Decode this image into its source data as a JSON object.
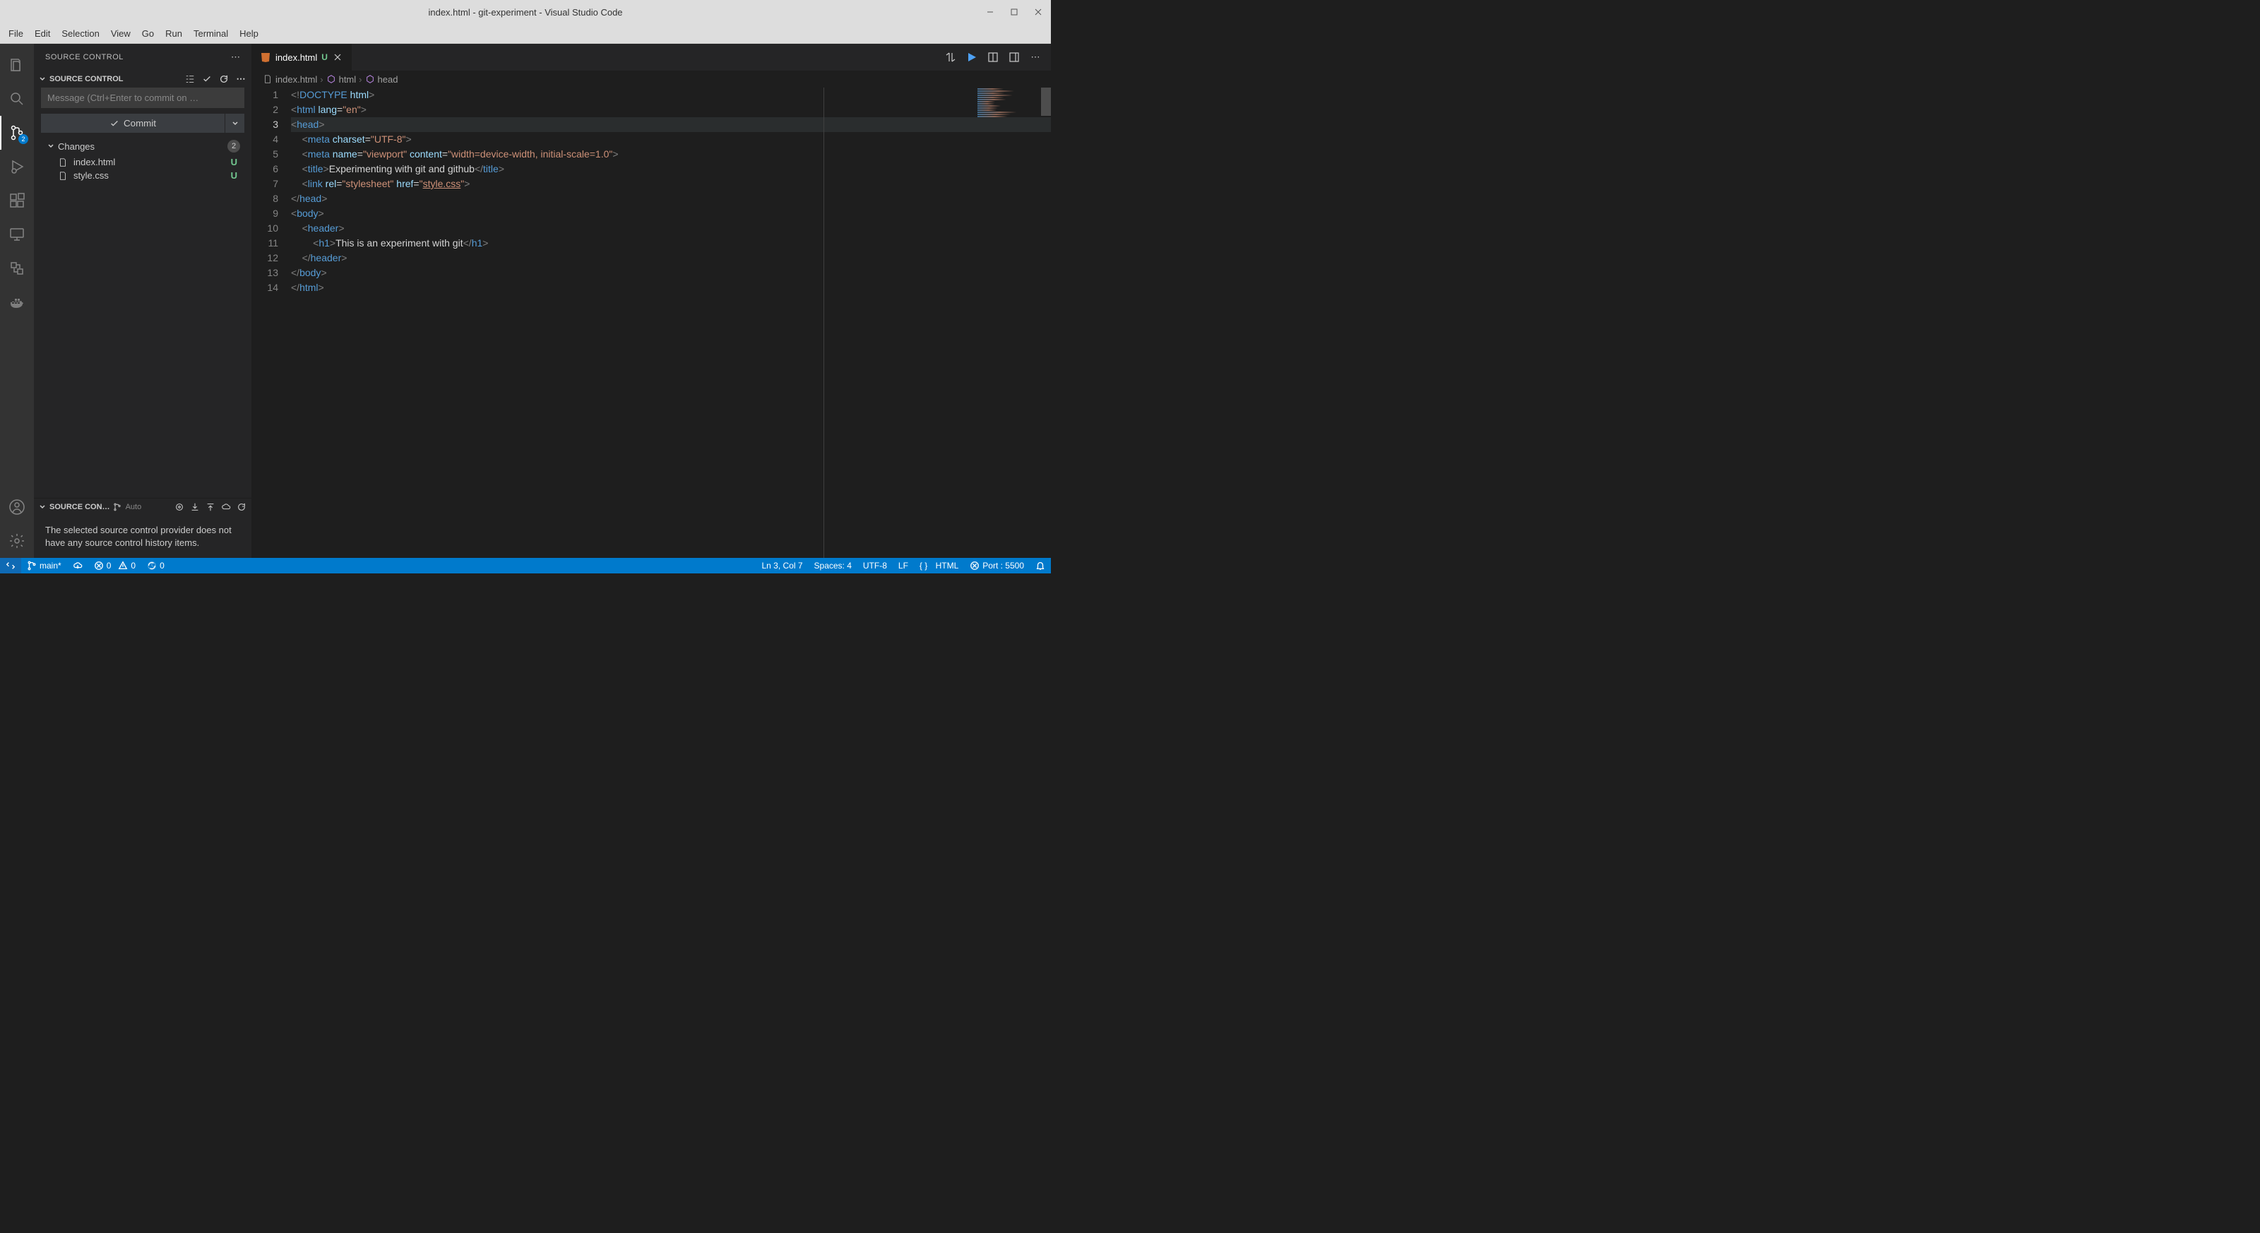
{
  "titlebar": {
    "title": "index.html - git-experiment - Visual Studio Code"
  },
  "menubar": {
    "items": [
      "File",
      "Edit",
      "Selection",
      "View",
      "Go",
      "Run",
      "Terminal",
      "Help"
    ]
  },
  "activitybar": {
    "scm_badge": "2"
  },
  "sidebar": {
    "title": "SOURCE CONTROL",
    "panel_label": "SOURCE CONTROL",
    "commit_placeholder": "Message (Ctrl+Enter to commit on …",
    "commit_button": "Commit",
    "changes_label": "Changes",
    "changes_count": "2",
    "files": [
      {
        "name": "index.html",
        "status": "U"
      },
      {
        "name": "style.css",
        "status": "U"
      }
    ],
    "graph_label": "SOURCE CON…",
    "graph_auto": "Auto",
    "graph_empty": "The selected source control provider does not have any source control history items."
  },
  "tab": {
    "label": "index.html",
    "status": "U"
  },
  "breadcrumbs": {
    "file": "index.html",
    "path1": "html",
    "path2": "head"
  },
  "code_lines": [
    {
      "n": "1",
      "indent": 0,
      "html": "<span class='tk-bracket'>&lt;!</span><span class='tk-doctype-kw'>DOCTYPE</span><span class='tk-text'> </span><span class='tk-attr'>html</span><span class='tk-bracket'>&gt;</span>"
    },
    {
      "n": "2",
      "indent": 0,
      "html": "<span class='tk-bracket'>&lt;</span><span class='tk-tag'>html</span><span class='tk-text'> </span><span class='tk-attr'>lang</span><span class='tk-text'>=</span><span class='tk-string'>\"en\"</span><span class='tk-bracket'>&gt;</span>"
    },
    {
      "n": "3",
      "indent": 0,
      "active": true,
      "html": "<span class='tk-bracket'>&lt;</span><span class='tk-tag'>head</span><span class='tk-bracket'>&gt;</span>"
    },
    {
      "n": "4",
      "indent": 1,
      "html": "<span class='tk-bracket'>&lt;</span><span class='tk-tag'>meta</span><span class='tk-text'> </span><span class='tk-attr'>charset</span><span class='tk-text'>=</span><span class='tk-string'>\"UTF-8\"</span><span class='tk-bracket'>&gt;</span>"
    },
    {
      "n": "5",
      "indent": 1,
      "html": "<span class='tk-bracket'>&lt;</span><span class='tk-tag'>meta</span><span class='tk-text'> </span><span class='tk-attr'>name</span><span class='tk-text'>=</span><span class='tk-string'>\"viewport\"</span><span class='tk-text'> </span><span class='tk-attr'>content</span><span class='tk-text'>=</span><span class='tk-string'>\"width=device-width, initial-scale=1.0\"</span><span class='tk-bracket'>&gt;</span>"
    },
    {
      "n": "6",
      "indent": 1,
      "html": "<span class='tk-bracket'>&lt;</span><span class='tk-tag'>title</span><span class='tk-bracket'>&gt;</span><span class='tk-text'>Experimenting with git and github</span><span class='tk-bracket'>&lt;/</span><span class='tk-tag'>title</span><span class='tk-bracket'>&gt;</span>"
    },
    {
      "n": "7",
      "indent": 1,
      "html": "<span class='tk-bracket'>&lt;</span><span class='tk-tag'>link</span><span class='tk-text'> </span><span class='tk-attr'>rel</span><span class='tk-text'>=</span><span class='tk-string'>\"stylesheet\"</span><span class='tk-text'> </span><span class='tk-attr'>href</span><span class='tk-text'>=</span><span class='tk-string'>\"</span><span class='tk-string tk-link'>style.css</span><span class='tk-string'>\"</span><span class='tk-bracket'>&gt;</span>"
    },
    {
      "n": "8",
      "indent": 0,
      "html": "<span class='tk-bracket'>&lt;/</span><span class='tk-tag'>head</span><span class='tk-bracket'>&gt;</span>"
    },
    {
      "n": "9",
      "indent": 0,
      "html": "<span class='tk-bracket'>&lt;</span><span class='tk-tag'>body</span><span class='tk-bracket'>&gt;</span>"
    },
    {
      "n": "10",
      "indent": 1,
      "html": "<span class='tk-bracket'>&lt;</span><span class='tk-tag'>header</span><span class='tk-bracket'>&gt;</span>"
    },
    {
      "n": "11",
      "indent": 2,
      "html": "<span class='tk-bracket'>&lt;</span><span class='tk-tag'>h1</span><span class='tk-bracket'>&gt;</span><span class='tk-text'>This is an experiment with git</span><span class='tk-bracket'>&lt;/</span><span class='tk-tag'>h1</span><span class='tk-bracket'>&gt;</span>"
    },
    {
      "n": "12",
      "indent": 1,
      "html": "<span class='tk-bracket'>&lt;/</span><span class='tk-tag'>header</span><span class='tk-bracket'>&gt;</span>"
    },
    {
      "n": "13",
      "indent": 0,
      "html": "<span class='tk-bracket'>&lt;/</span><span class='tk-tag'>body</span><span class='tk-bracket'>&gt;</span>"
    },
    {
      "n": "14",
      "indent": 0,
      "html": "<span class='tk-bracket'>&lt;/</span><span class='tk-tag'>html</span><span class='tk-bracket'>&gt;</span>"
    }
  ],
  "statusbar": {
    "branch": "main*",
    "errors": "0",
    "warnings": "0",
    "radio": "0",
    "cursor": "Ln 3, Col 7",
    "spaces": "Spaces: 4",
    "encoding": "UTF-8",
    "eol": "LF",
    "lang": "HTML",
    "port": "Port : 5500"
  }
}
